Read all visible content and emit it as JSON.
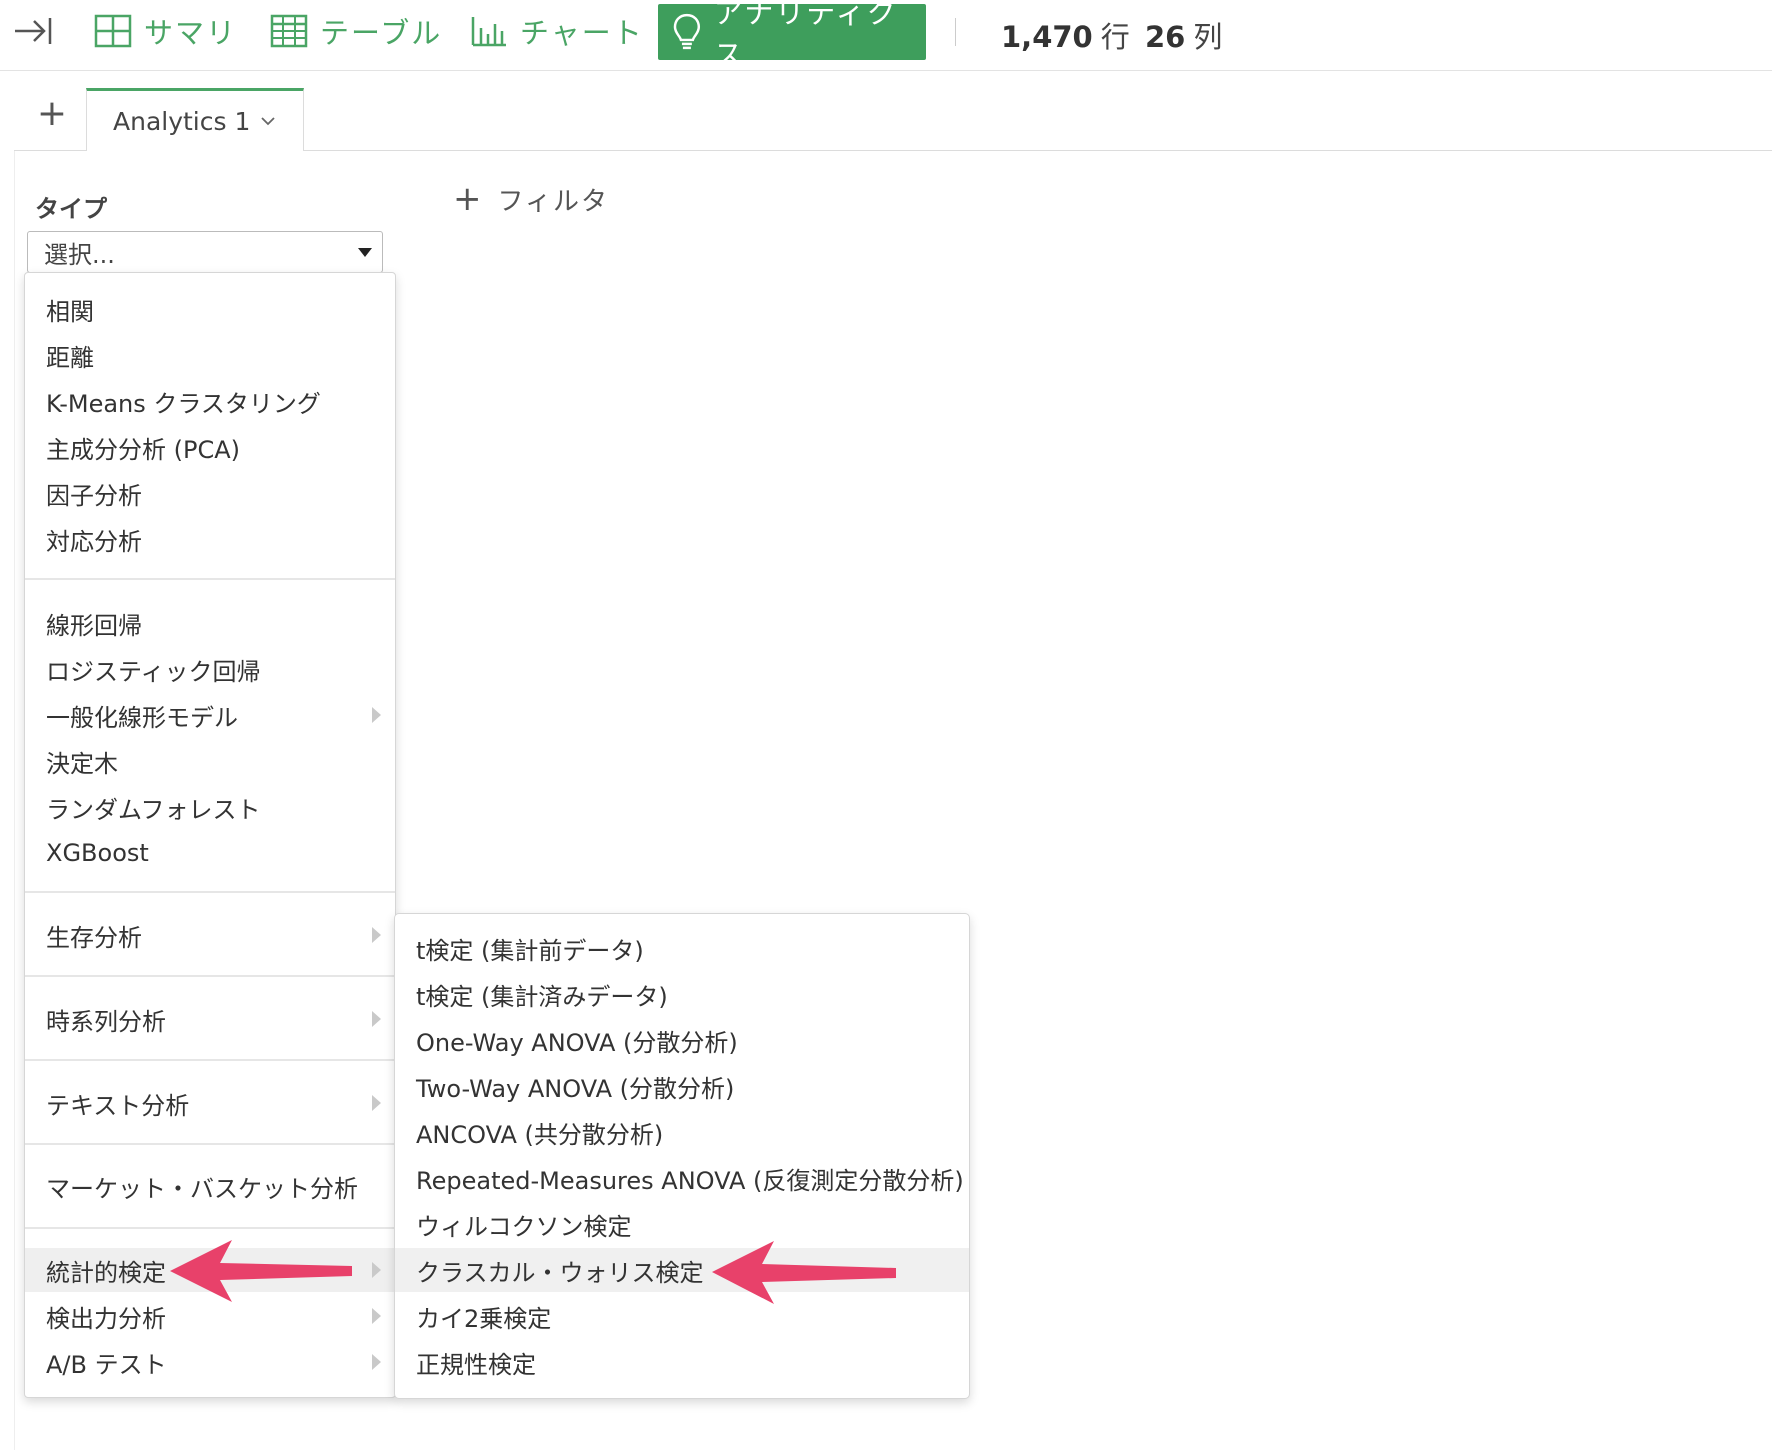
{
  "toolbar": {
    "summary_label": "サマリ",
    "table_label": "テーブル",
    "chart_label": "チャート",
    "analytics_label": "アナリティクス",
    "rows_count": "1,470",
    "rows_unit": "行",
    "cols_count": "26",
    "cols_unit": "列"
  },
  "tabs": {
    "add_label": "+",
    "active_tab_label": "Analytics 1"
  },
  "panel": {
    "type_label": "タイプ",
    "select_value": "選択...",
    "filter_label": "フィルタ"
  },
  "menu": {
    "items": [
      "相関",
      "距離",
      "K-Means クラスタリング",
      "主成分分析 (PCA)",
      "因子分析",
      "対応分析",
      "線形回帰",
      "ロジスティック回帰",
      "一般化線形モデル",
      "決定木",
      "ランダムフォレスト",
      "XGBoost",
      "生存分析",
      "時系列分析",
      "テキスト分析",
      "マーケット・バスケット分析",
      "統計的検定",
      "検出力分析",
      "A/B テスト"
    ]
  },
  "submenu": {
    "items": [
      "t検定 (集計前データ)",
      "t検定 (集計済みデータ)",
      "One-Way ANOVA (分散分析)",
      "Two-Way ANOVA (分散分析)",
      "ANCOVA (共分散分析)",
      "Repeated-Measures ANOVA (反復測定分散分析)",
      "ウィルコクソン検定",
      "クラスカル・ウォリス検定",
      "カイ2乗検定",
      "正規性検定"
    ]
  },
  "colors": {
    "accent": "#4aa565",
    "accent_active_bg": "#3e9e5c",
    "annotation_arrow": "#e8416a"
  }
}
